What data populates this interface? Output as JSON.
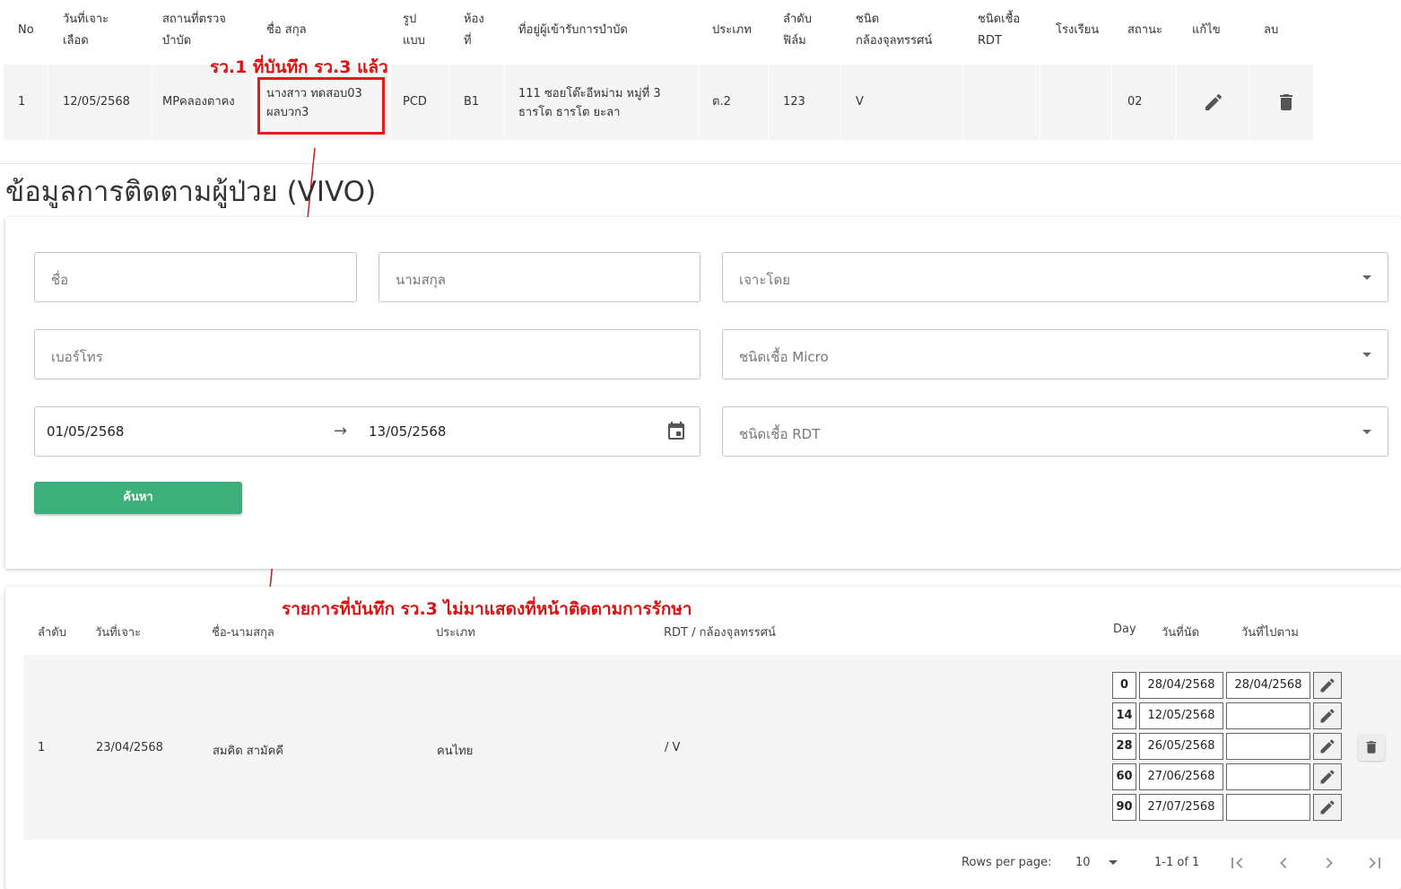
{
  "top_table": {
    "headers": {
      "no": "No",
      "draw_date_1": "วันที่เจาะ",
      "draw_date_2": "เลือด",
      "place_1": "สถานที่ตรวจ",
      "place_2": "บำบัด",
      "name": "ชื่อ สกุล",
      "form_1": "รูป",
      "form_2": "แบบ",
      "room_1": "ห้อง",
      "room_2": "ที่",
      "address": "ที่อยู่ผู้เข้ารับการบำบัด",
      "type": "ประเภท",
      "film_1": "ลำดับ",
      "film_2": "ฟิล์ม",
      "micro_1": "ชนิด",
      "micro_2": "กล้องจุลทรรศน์",
      "rdt_1": "ชนิดเชื้อ",
      "rdt_2": "RDT",
      "school": "โรงเรียน",
      "status": "สถานะ",
      "edit": "แก้ไข",
      "delete": "ลบ"
    },
    "row": {
      "no": "1",
      "draw_date": "12/05/2568",
      "place": "MPคลองตาคง",
      "name_1": "นางสาว ทดสอบ03",
      "name_2": "ผลบวก3",
      "form": "PCD",
      "room": "B1",
      "address_1": "111 ซอยโต๊ะอีหม่าม หมู่ที่ 3",
      "address_2": "ธารโต ธารโต ยะลา",
      "type": "ต.2",
      "film": "123",
      "micro": "V",
      "rdt": "",
      "school": "",
      "status": "02"
    }
  },
  "annotations": {
    "top": "รว.1 ที่บันทึก รว.3 แล้ว",
    "bottom": "รายการที่บันทึก รว.3 ไม่มาแสดงที่หน้าติดตามการรักษา",
    "color": "#dd1111"
  },
  "page_title": "ข้อมูลการติดตามผู้ป่วย (VIVO)",
  "search": {
    "first_name_placeholder": "ชื่อ",
    "last_name_placeholder": "นามสกุล",
    "drawn_by_placeholder": "เจาะโดย",
    "phone_placeholder": "เบอร์โทร",
    "micro_type_placeholder": "ชนิดเชื้อ Micro",
    "rdt_type_placeholder": "ชนิดเชื้อ RDT",
    "date_from": "01/05/2568",
    "date_arrow": "→",
    "date_to": "13/05/2568",
    "search_button": "ค้นหา",
    "button_color": "#3daf7a"
  },
  "results": {
    "headers": {
      "order": "ลำดับ",
      "draw_date": "วันที่เจาะ",
      "full_name": "ชื่อ-นามสกุล",
      "type": "ประเภท",
      "rdt_micro": "RDT / กล้องจุลทรรศน์",
      "day": "Day",
      "appointment": "วันที่นัด",
      "follow_up": "วันที่ไปตาม"
    },
    "row": {
      "order": "1",
      "draw_date": "23/04/2568",
      "full_name": "สมคิด สามัคคี",
      "type": "คนไทย",
      "rdt_micro": "/ V",
      "schedule": [
        {
          "day": "0",
          "appointment": "28/04/2568",
          "follow_up": "28/04/2568"
        },
        {
          "day": "14",
          "appointment": "12/05/2568",
          "follow_up": ""
        },
        {
          "day": "28",
          "appointment": "26/05/2568",
          "follow_up": ""
        },
        {
          "day": "60",
          "appointment": "27/06/2568",
          "follow_up": ""
        },
        {
          "day": "90",
          "appointment": "27/07/2568",
          "follow_up": ""
        }
      ]
    },
    "pagination": {
      "rows_per_page_label": "Rows per page:",
      "rows_per_page": "10",
      "range": "1-1 of 1"
    }
  }
}
